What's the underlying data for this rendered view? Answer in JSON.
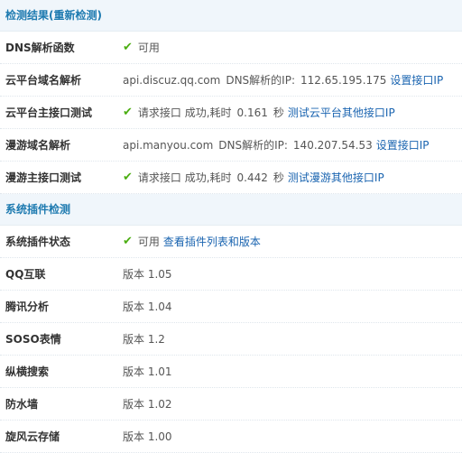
{
  "sections": [
    {
      "title": "检测结果(重新检测)"
    },
    {
      "title": "系统插件检测"
    }
  ],
  "checks": {
    "dns": {
      "label": "DNS解析函数",
      "status": "可用"
    },
    "cloud_domain": {
      "label": "云平台域名解析",
      "domain": "api.discuz.qq.com",
      "ip_label": "DNS解析的IP:",
      "ip": "112.65.195.175",
      "link": "设置接口IP"
    },
    "cloud_api": {
      "label": "云平台主接口测试",
      "status": "请求接口 成功,耗时",
      "time": "0.161",
      "unit": "秒",
      "link": "测试云平台其他接口IP"
    },
    "manyou_domain": {
      "label": "漫游域名解析",
      "domain": "api.manyou.com",
      "ip_label": "DNS解析的IP:",
      "ip": "140.207.54.53",
      "link": "设置接口IP"
    },
    "manyou_api": {
      "label": "漫游主接口测试",
      "status": "请求接口 成功,耗时",
      "time": "0.442",
      "unit": "秒",
      "link": "测试漫游其他接口IP"
    }
  },
  "plugins": {
    "status": {
      "label": "系统插件状态",
      "value": "可用",
      "link": "查看插件列表和版本"
    },
    "items": [
      {
        "label": "QQ互联",
        "version": "版本 1.05"
      },
      {
        "label": "腾讯分析",
        "version": "版本 1.04"
      },
      {
        "label": "SOSO表情",
        "version": "版本 1.2"
      },
      {
        "label": "纵横搜索",
        "version": "版本 1.01"
      },
      {
        "label": "防水墙",
        "version": "版本 1.02"
      },
      {
        "label": "旋风云存储",
        "version": "版本 1.00"
      }
    ]
  },
  "icons": {
    "ok": "check-icon"
  },
  "colors": {
    "accent": "#1d7ab0",
    "link": "#1a64b0",
    "ok": "#4cae12",
    "section_bg": "#f0f6fb"
  }
}
